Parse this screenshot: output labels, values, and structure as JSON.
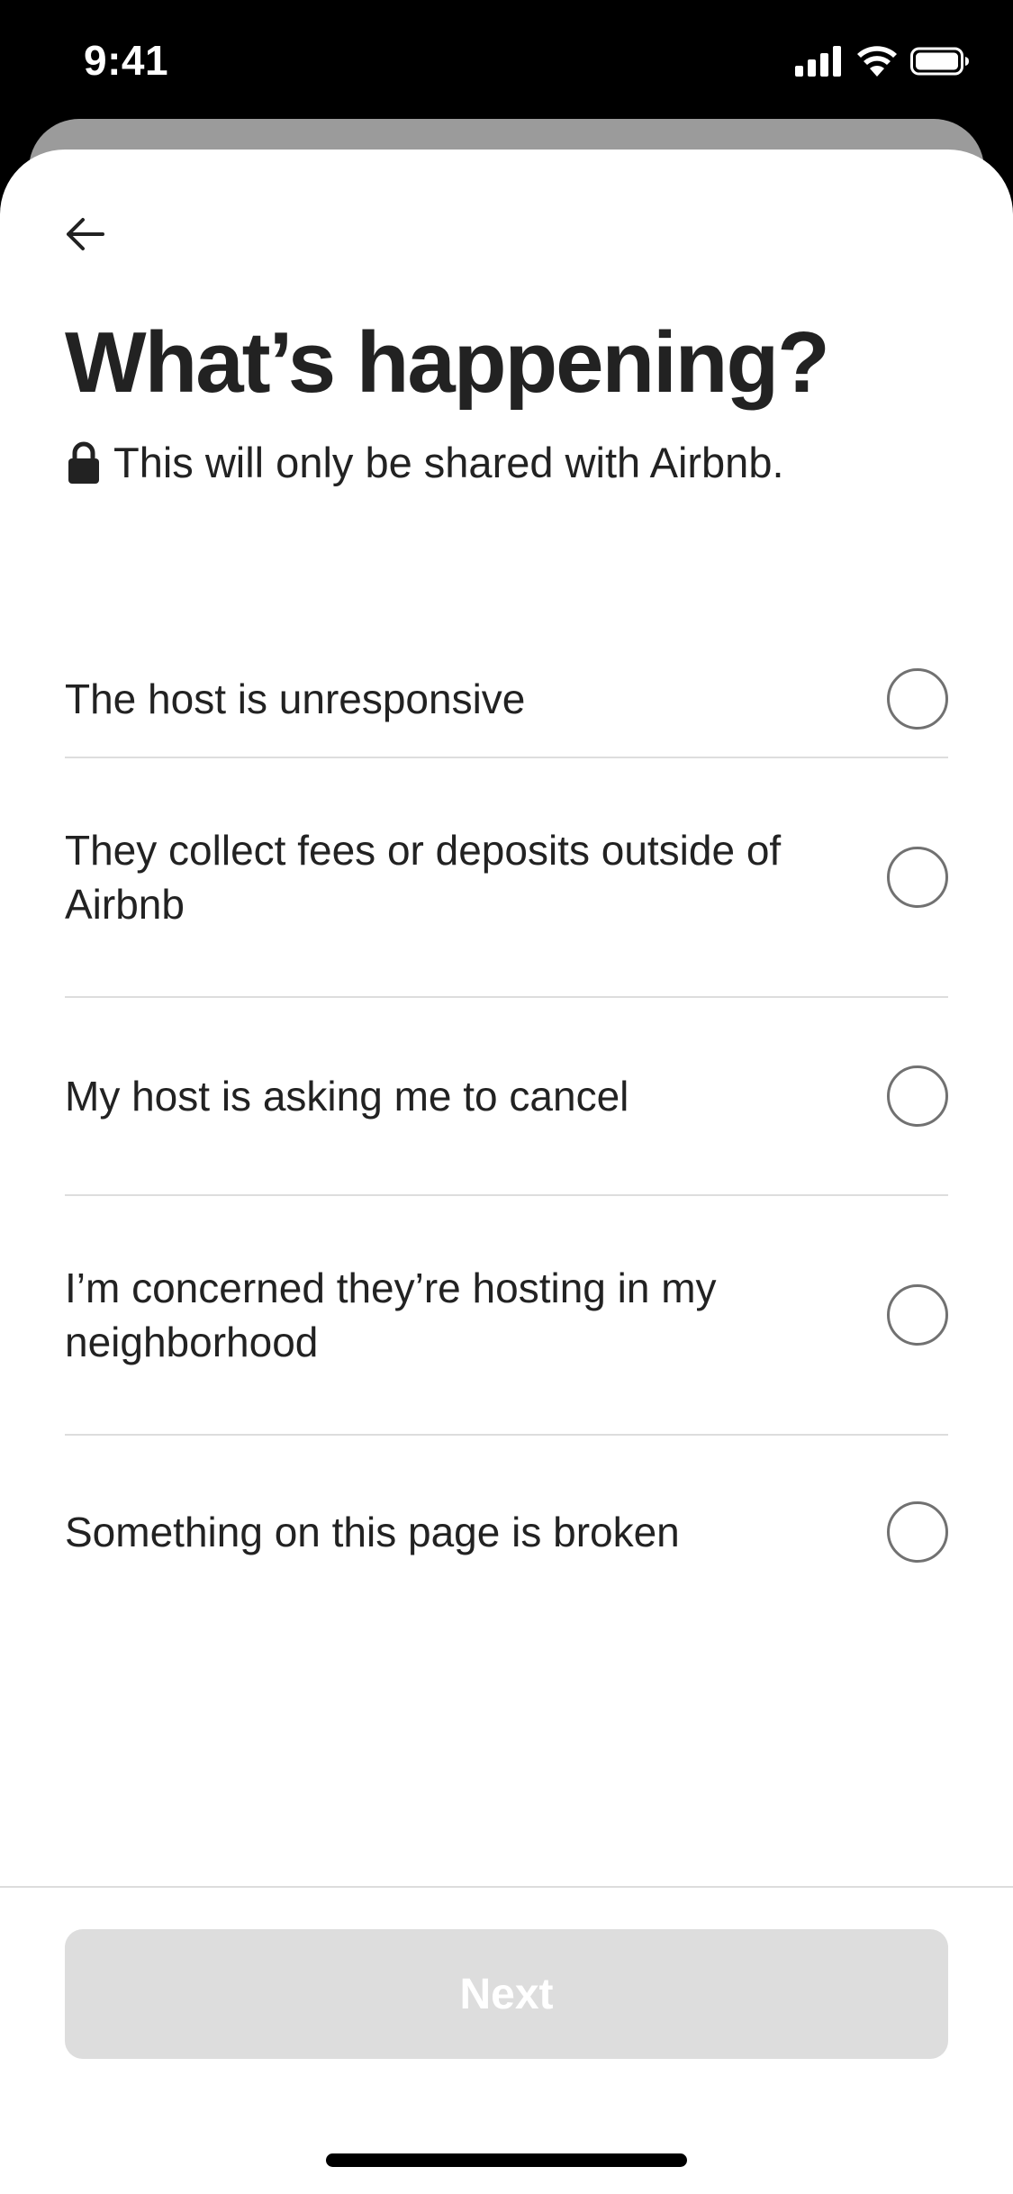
{
  "status_bar": {
    "time": "9:41",
    "icons": [
      "cellular-signal-icon",
      "wifi-icon",
      "battery-icon"
    ]
  },
  "header": {
    "back_icon": "arrow-left-icon",
    "title": "What’s happening?",
    "subtitle_icon": "lock-icon",
    "subtitle": "This will only be shared with Airbnb."
  },
  "options": [
    {
      "label": "The host is unresponsive",
      "selected": false
    },
    {
      "label": "They collect fees or deposits outside of Airbnb",
      "selected": false
    },
    {
      "label": "My host is asking me to cancel",
      "selected": false
    },
    {
      "label": "I’m concerned they’re hosting in my neighborhood",
      "selected": false
    },
    {
      "label": "Something on this page is broken",
      "selected": false
    }
  ],
  "footer": {
    "next_label": "Next",
    "next_enabled": false
  },
  "colors": {
    "text": "#222222",
    "radio_border": "#717171",
    "divider": "#dddddd",
    "button_disabled_bg": "#dddddd"
  }
}
